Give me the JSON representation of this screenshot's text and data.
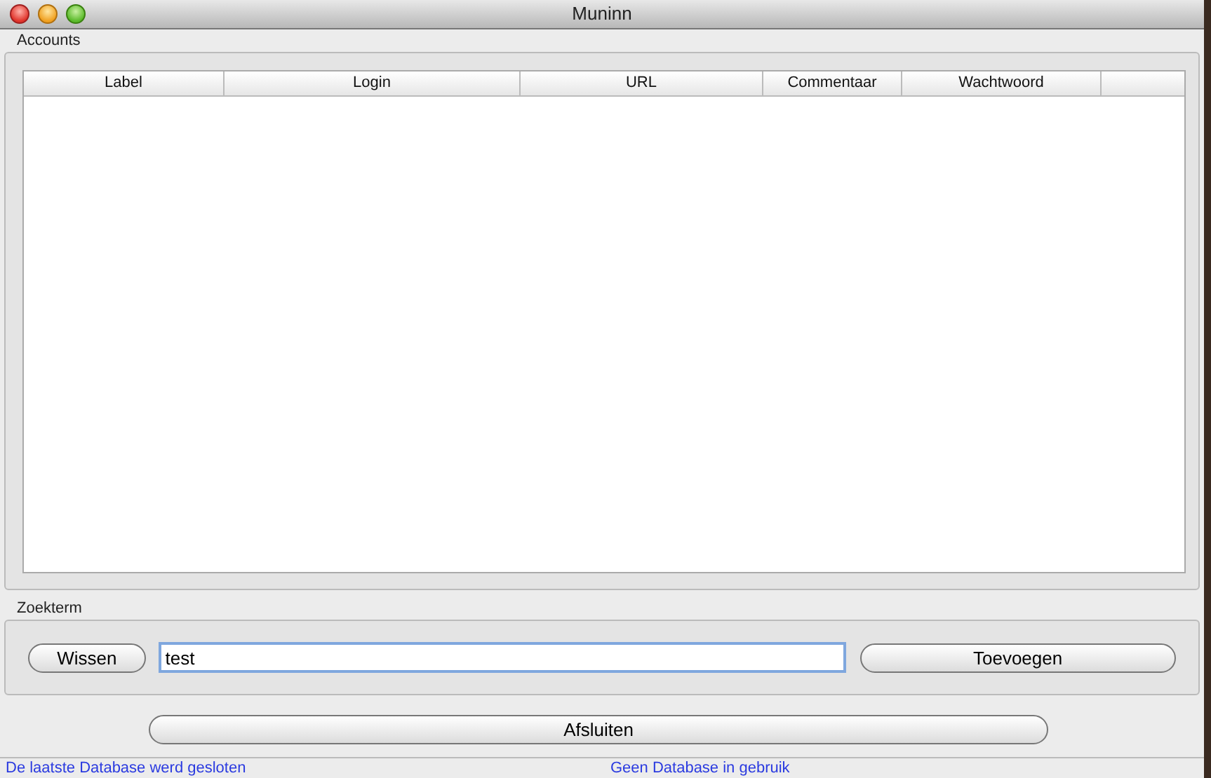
{
  "window": {
    "title": "Muninn"
  },
  "accounts": {
    "label": "Accounts",
    "table": {
      "columns": [
        "Label",
        "Login",
        "URL",
        "Commentaar",
        "Wachtwoord"
      ]
    }
  },
  "search": {
    "label": "Zoekterm",
    "clear_button": "Wissen",
    "value": "test",
    "add_button": "Toevoegen"
  },
  "close_button": "Afsluiten",
  "status_bar": {
    "left": "De laatste Database werd gesloten",
    "right": "Geen Database in gebruik"
  }
}
